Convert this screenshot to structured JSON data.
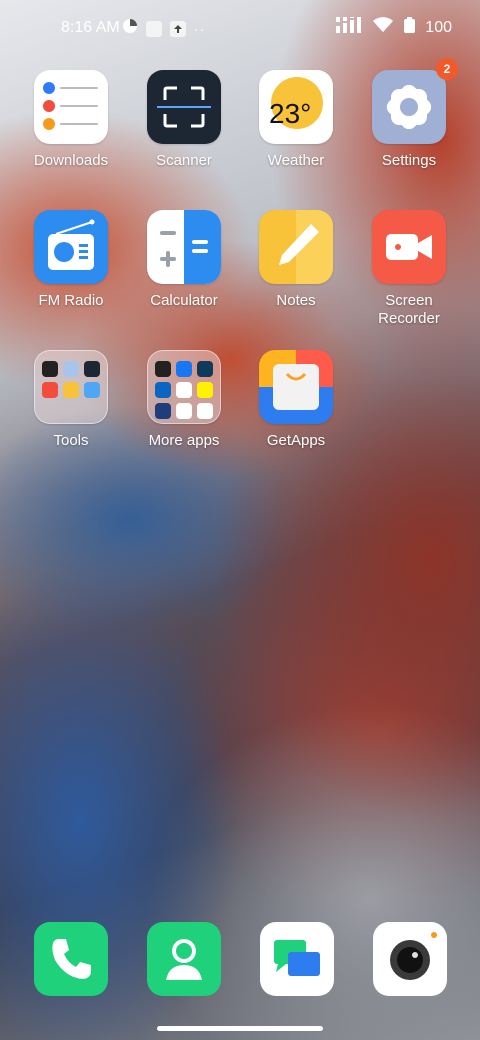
{
  "status_bar": {
    "time": "8:16 AM",
    "battery": "100",
    "icons": [
      "data-saver-icon",
      "notification-square-icon",
      "upload-icon",
      "more-dots-icon",
      "signal-icon",
      "wifi-icon",
      "battery-icon"
    ]
  },
  "apps": [
    {
      "label": "Downloads",
      "icon": "downloads-list-icon"
    },
    {
      "label": "Scanner",
      "icon": "scanner-icon"
    },
    {
      "label": "Weather",
      "icon": "weather-sun-icon",
      "temp": "23°"
    },
    {
      "label": "Settings",
      "icon": "gear-icon",
      "badge": "2"
    },
    {
      "label": "FM Radio",
      "icon": "radio-icon"
    },
    {
      "label": "Calculator",
      "icon": "calculator-icon"
    },
    {
      "label": "Notes",
      "icon": "pencil-icon"
    },
    {
      "label": "Screen\nRecorder",
      "label_line1": "Screen",
      "label_line2": "Recorder",
      "icon": "video-camera-icon"
    },
    {
      "label": "Tools",
      "icon": "folder-icon"
    },
    {
      "label": "More apps",
      "icon": "folder-icon"
    },
    {
      "label": "GetApps",
      "icon": "shopping-bag-icon"
    }
  ],
  "dock": [
    {
      "name": "Phone",
      "icon": "phone-icon"
    },
    {
      "name": "Contacts",
      "icon": "person-icon"
    },
    {
      "name": "Messages",
      "icon": "chat-bubbles-icon"
    },
    {
      "name": "Camera",
      "icon": "camera-lens-icon"
    }
  ],
  "colors": {
    "accent_badge": "#f35a2a",
    "dock_green": "#1ed17a",
    "calculator_blue": "#2d8cf0",
    "notes_yellow": "#f8c338",
    "recorder_red": "#f45a45"
  }
}
